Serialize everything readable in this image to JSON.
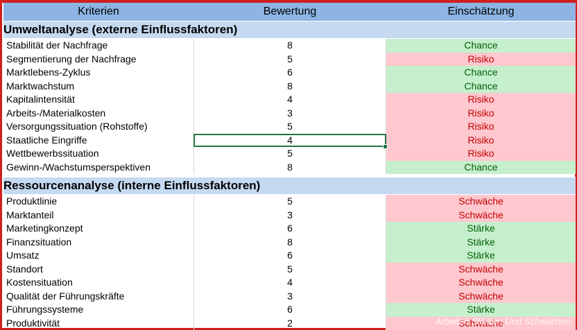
{
  "header": {
    "col1": "Kriterien",
    "col2": "Bewertung",
    "col3": "Einschätzung"
  },
  "sections": [
    {
      "title": "Umweltanalyse (externe Einflussfaktoren)",
      "rows": [
        {
          "k": "Stabilität der Nachfrage",
          "b": "8",
          "e": "Chance",
          "type": "good"
        },
        {
          "k": "Segmentierung der Nachfrage",
          "b": "5",
          "e": "Risiko",
          "type": "bad"
        },
        {
          "k": "Marktlebens-Zyklus",
          "b": "6",
          "e": "Chance",
          "type": "good"
        },
        {
          "k": "Marktwachstum",
          "b": "8",
          "e": "Chance",
          "type": "good"
        },
        {
          "k": "Kapitalintensität",
          "b": "4",
          "e": "Risiko",
          "type": "bad"
        },
        {
          "k": "Arbeits-/Materialkosten",
          "b": "3",
          "e": "Risiko",
          "type": "bad"
        },
        {
          "k": "Versorgungssituation (Rohstoffe)",
          "b": "5",
          "e": "Risiko",
          "type": "bad"
        },
        {
          "k": "Staatliche Eingriffe",
          "b": "4",
          "e": "Risiko",
          "type": "bad",
          "selected": true
        },
        {
          "k": "Wettbewerbssituation",
          "b": "5",
          "e": "Risiko",
          "type": "bad"
        },
        {
          "k": "Gewinn-/Wachstumsperspektiven",
          "b": "8",
          "e": "Chance",
          "type": "good"
        }
      ]
    },
    {
      "title": "Ressourcenanalyse (interne Einflussfaktoren)",
      "rows": [
        {
          "k": "Produktlinie",
          "b": "5",
          "e": "Schwäche",
          "type": "bad"
        },
        {
          "k": "Marktanteil",
          "b": "3",
          "e": "Schwäche",
          "type": "bad"
        },
        {
          "k": "Marketingkonzept",
          "b": "6",
          "e": "Stärke",
          "type": "good"
        },
        {
          "k": "Finanzsituation",
          "b": "8",
          "e": "Stärke",
          "type": "good"
        },
        {
          "k": "Umsatz",
          "b": "6",
          "e": "Stärke",
          "type": "good"
        },
        {
          "k": "Standort",
          "b": "5",
          "e": "Schwäche",
          "type": "bad"
        },
        {
          "k": "Kostensituation",
          "b": "4",
          "e": "Schwäche",
          "type": "bad"
        },
        {
          "k": "Qualität der Führungskräfte",
          "b": "3",
          "e": "Schwäche",
          "type": "bad"
        },
        {
          "k": "Führungssysteme",
          "b": "6",
          "e": "Stärke",
          "type": "good"
        },
        {
          "k": "Produktivität",
          "b": "2",
          "e": "Schwäche",
          "type": "bad"
        }
      ]
    }
  ],
  "watermark": "Arbeiten Stärken Und Schwächen",
  "colors": {
    "header_bg": "#8db4e2",
    "section_bg": "#c5d9f1",
    "good_bg": "#c6efce",
    "good_fg": "#006100",
    "bad_bg": "#ffc7ce",
    "bad_fg": "#c00000",
    "frame": "#d01f1f"
  }
}
